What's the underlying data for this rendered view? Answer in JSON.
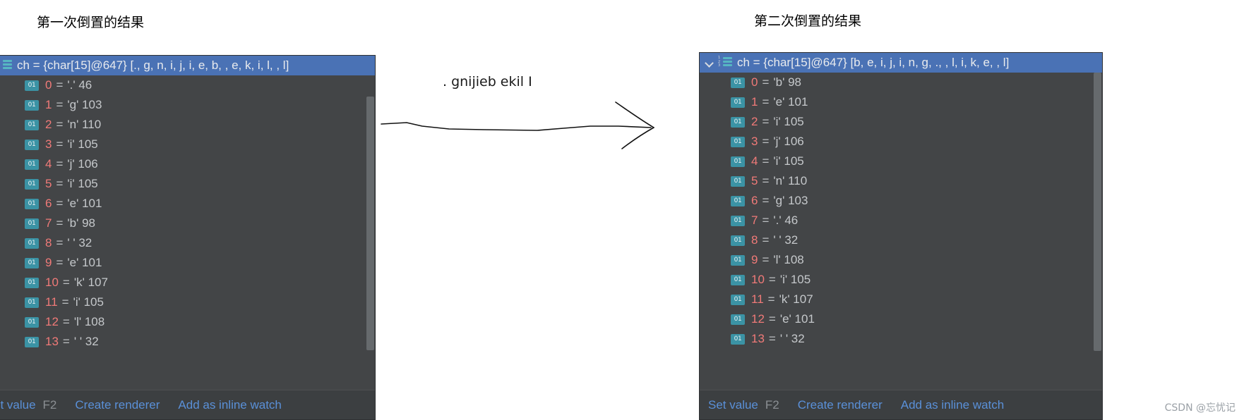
{
  "captions": {
    "left": "第一次倒置的结果",
    "right": "第二次倒置的结果"
  },
  "annotation": {
    "text": ". gnijieb ekil I",
    "arrow_icon": "hand-drawn-arrow-icon"
  },
  "watermark": "CSDN @忘忧记",
  "colors": {
    "panel_bg": "#434547",
    "header_selected": "#4a72b5",
    "index_red": "#f07a78",
    "value_gray": "#c5c8cb",
    "link_blue": "#5a90d8",
    "icon_teal": "#3b93a5"
  },
  "left_panel": {
    "header": {
      "label": "ch = {char[15]@647} [., g, n, i, j, i, e, b,  , e, k, i, l,  , l]",
      "icon": "array-icon",
      "expanded": true
    },
    "rows": [
      {
        "icon": "primitive-01-icon",
        "index": "0",
        "eq": "=",
        "value": "'.' 46"
      },
      {
        "icon": "primitive-01-icon",
        "index": "1",
        "eq": "=",
        "value": "'g' 103"
      },
      {
        "icon": "primitive-01-icon",
        "index": "2",
        "eq": "=",
        "value": "'n' 110"
      },
      {
        "icon": "primitive-01-icon",
        "index": "3",
        "eq": "=",
        "value": "'i' 105"
      },
      {
        "icon": "primitive-01-icon",
        "index": "4",
        "eq": "=",
        "value": "'j' 106"
      },
      {
        "icon": "primitive-01-icon",
        "index": "5",
        "eq": "=",
        "value": "'i' 105"
      },
      {
        "icon": "primitive-01-icon",
        "index": "6",
        "eq": "=",
        "value": "'e' 101"
      },
      {
        "icon": "primitive-01-icon",
        "index": "7",
        "eq": "=",
        "value": "'b' 98"
      },
      {
        "icon": "primitive-01-icon",
        "index": "8",
        "eq": "=",
        "value": "' ' 32"
      },
      {
        "icon": "primitive-01-icon",
        "index": "9",
        "eq": "=",
        "value": "'e' 101"
      },
      {
        "icon": "primitive-01-icon",
        "index": "10",
        "eq": "=",
        "value": "'k' 107"
      },
      {
        "icon": "primitive-01-icon",
        "index": "11",
        "eq": "=",
        "value": "'i' 105"
      },
      {
        "icon": "primitive-01-icon",
        "index": "12",
        "eq": "=",
        "value": "'l' 108"
      },
      {
        "icon": "primitive-01-icon",
        "index": "13",
        "eq": "=",
        "value": "' ' 32"
      }
    ],
    "actions": {
      "set_value": "et value",
      "set_value_key": "F2",
      "create_renderer": "Create renderer",
      "add_inline_watch": "Add as inline watch"
    }
  },
  "right_panel": {
    "header": {
      "label": "ch = {char[15]@647} [b, e, i, j, i, n, g, .,  , l, i, k, e,  , l]",
      "icon": "array-icon",
      "expanded": true
    },
    "rows": [
      {
        "icon": "primitive-01-icon",
        "index": "0",
        "eq": "=",
        "value": "'b' 98"
      },
      {
        "icon": "primitive-01-icon",
        "index": "1",
        "eq": "=",
        "value": "'e' 101"
      },
      {
        "icon": "primitive-01-icon",
        "index": "2",
        "eq": "=",
        "value": "'i' 105"
      },
      {
        "icon": "primitive-01-icon",
        "index": "3",
        "eq": "=",
        "value": "'j' 106"
      },
      {
        "icon": "primitive-01-icon",
        "index": "4",
        "eq": "=",
        "value": "'i' 105"
      },
      {
        "icon": "primitive-01-icon",
        "index": "5",
        "eq": "=",
        "value": "'n' 110"
      },
      {
        "icon": "primitive-01-icon",
        "index": "6",
        "eq": "=",
        "value": "'g' 103"
      },
      {
        "icon": "primitive-01-icon",
        "index": "7",
        "eq": "=",
        "value": "'.' 46"
      },
      {
        "icon": "primitive-01-icon",
        "index": "8",
        "eq": "=",
        "value": "' ' 32"
      },
      {
        "icon": "primitive-01-icon",
        "index": "9",
        "eq": "=",
        "value": "'l' 108"
      },
      {
        "icon": "primitive-01-icon",
        "index": "10",
        "eq": "=",
        "value": "'i' 105"
      },
      {
        "icon": "primitive-01-icon",
        "index": "11",
        "eq": "=",
        "value": "'k' 107"
      },
      {
        "icon": "primitive-01-icon",
        "index": "12",
        "eq": "=",
        "value": "'e' 101"
      },
      {
        "icon": "primitive-01-icon",
        "index": "13",
        "eq": "=",
        "value": "' ' 32"
      }
    ],
    "actions": {
      "set_value": "Set value",
      "set_value_key": "F2",
      "create_renderer": "Create renderer",
      "add_inline_watch": "Add as inline watch"
    }
  }
}
